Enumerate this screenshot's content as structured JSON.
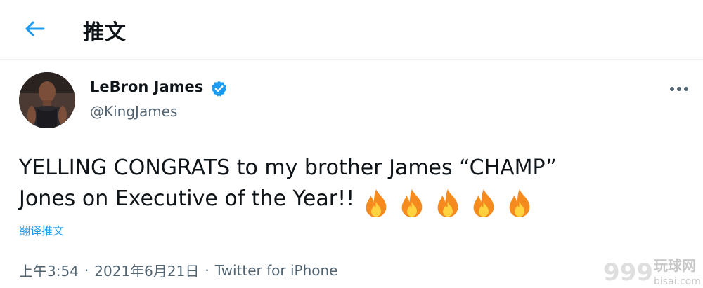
{
  "header": {
    "back_icon": "arrow-left-icon",
    "title": "推文"
  },
  "author": {
    "avatar_icon": "avatar",
    "name": "LeBron James",
    "verified_icon": "verified-badge-icon",
    "handle": "@KingJames"
  },
  "more_icon": "more-horizontal-icon",
  "tweet": {
    "line1": "YELLING CONGRATS to my brother James “CHAMP”",
    "line2": "Jones on Executive of the Year!!",
    "emoji": [
      "fire-emoji",
      "fire-emoji",
      "fire-emoji",
      "fire-emoji",
      "fire-emoji"
    ],
    "translate_label": "翻译推文"
  },
  "meta": {
    "time": "上午3:54",
    "separator": "·",
    "date": "2021年6月21日",
    "source": "Twitter for iPhone"
  },
  "watermark": {
    "number": "999",
    "cn": "玩球网",
    "domain": "bisai.com"
  },
  "colors": {
    "accent": "#1d9bf0",
    "text": "#0f1419",
    "secondary": "#536471",
    "divider": "#eff3f4"
  }
}
